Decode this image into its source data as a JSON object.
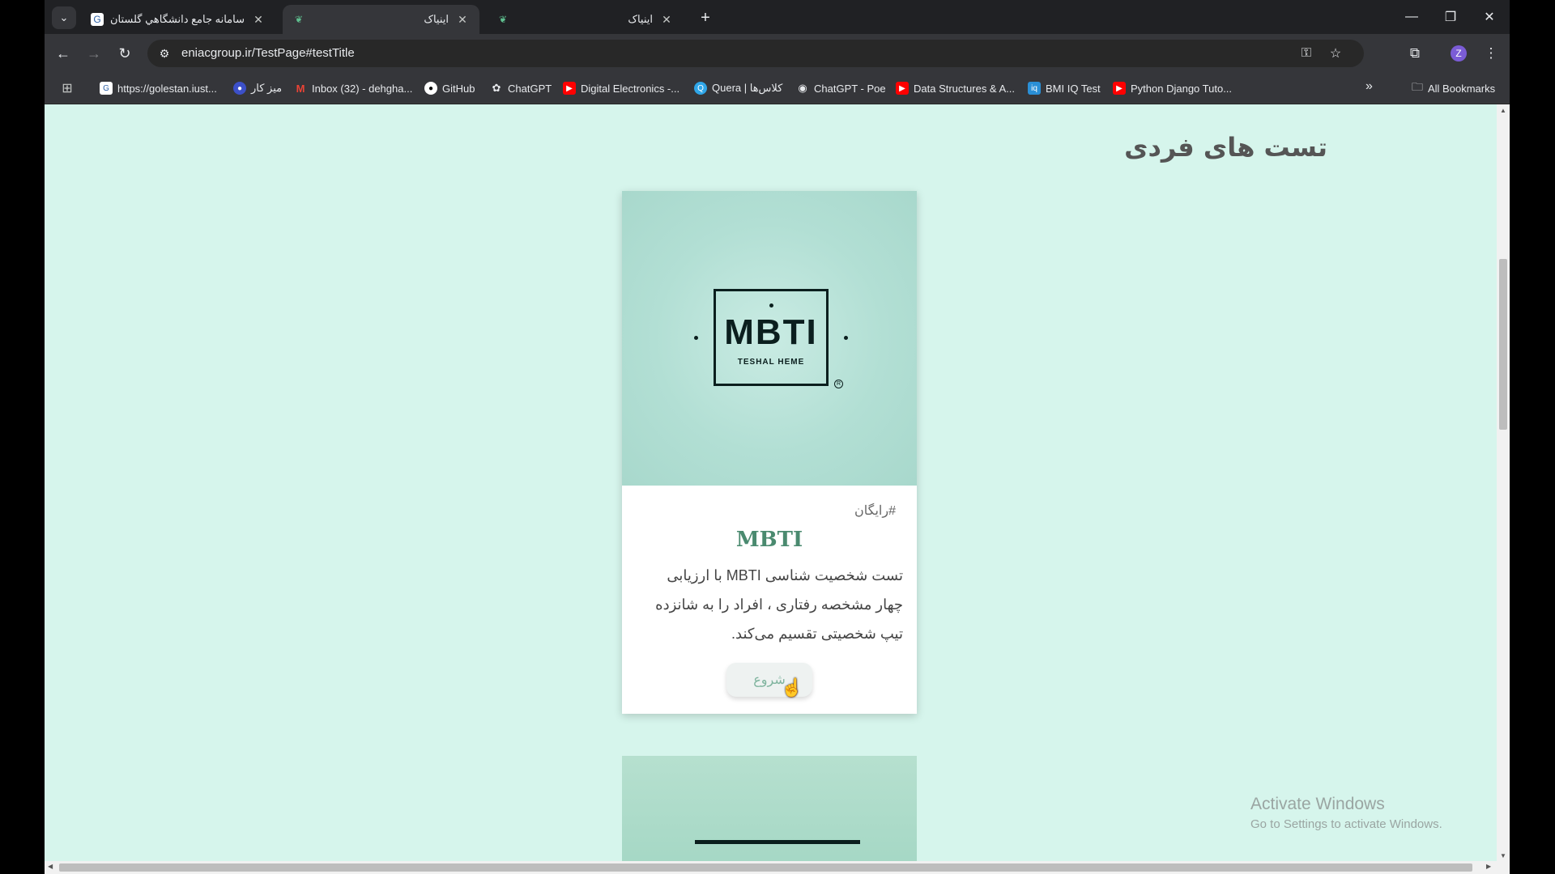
{
  "tabs": [
    {
      "title": "سامانه جامع دانشگاهي گلستان -",
      "favicon": "golestan-icon",
      "active": false
    },
    {
      "title": "اینیاک",
      "favicon": "eniac-leaf-icon",
      "active": true
    },
    {
      "title": "اینیاک",
      "favicon": "eniac-leaf-icon",
      "active": false
    }
  ],
  "url": "eniacgroup.ir/TestPage#testTitle",
  "bookmarks": [
    {
      "label": "https://golestan.iust...",
      "icon": "golestan-icon",
      "color": "#ffffff"
    },
    {
      "label": "میز کار",
      "icon": "dashboard-icon",
      "color": "#3c50c8"
    },
    {
      "label": "Inbox (32) - dehgha...",
      "icon": "gmail-icon",
      "color": "#ea4335"
    },
    {
      "label": "GitHub",
      "icon": "github-icon",
      "color": "#ffffff"
    },
    {
      "label": "ChatGPT",
      "icon": "openai-icon",
      "color": "#ffffff"
    },
    {
      "label": "Digital Electronics -...",
      "icon": "youtube-icon",
      "color": "#ff0000"
    },
    {
      "label": "Quera | کلاس‌ها",
      "icon": "quera-icon",
      "color": "#2fa6e8"
    },
    {
      "label": "ChatGPT - Poe",
      "icon": "poe-icon",
      "color": "#ffffff"
    },
    {
      "label": "Data Structures & A...",
      "icon": "youtube-icon",
      "color": "#ff0000"
    },
    {
      "label": "BMI IQ Test",
      "icon": "bmi-icon",
      "color": "#2a8fd6"
    },
    {
      "label": "Python Django Tuto...",
      "icon": "youtube-icon",
      "color": "#ff0000"
    }
  ],
  "all_bookmarks_label": "All Bookmarks",
  "profile_initial": "Z",
  "page": {
    "title": "تست های فردی",
    "card": {
      "logo_text": "MBTI",
      "logo_sub": "TESHAL HEME",
      "tag": "#رایگان",
      "name": "MBTI",
      "description": "تست شخصیت شناسی MBTI با ارزیابی چهار مشخصه رفتاری ، افراد را به شانزده تیپ شخصیتی تقسیم می‌کند.",
      "button": "شروع"
    }
  },
  "watermark": {
    "line1": "Activate Windows",
    "line2": "Go to Settings to activate Windows."
  }
}
